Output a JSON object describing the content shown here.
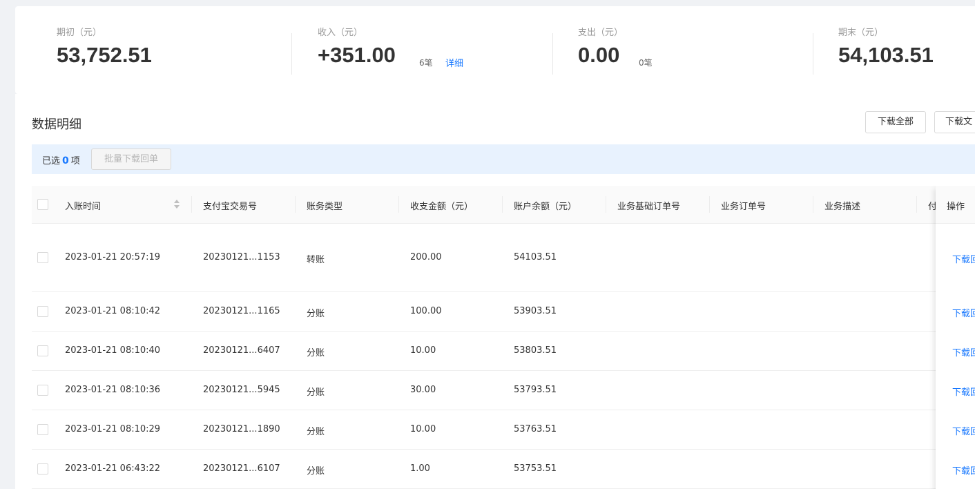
{
  "summary": {
    "opening": {
      "label": "期初（元）",
      "value": "53,752.51"
    },
    "income": {
      "label": "收入（元）",
      "value": "+351.00",
      "count": "6笔",
      "link": "详细"
    },
    "expense": {
      "label": "支出（元）",
      "value": "0.00",
      "count": "0笔"
    },
    "closing": {
      "label": "期末（元）",
      "value": "54,103.51"
    }
  },
  "detail": {
    "title": "数据明细",
    "download_all": "下载全部",
    "download_file": "下载文",
    "selection": {
      "prefix": "已选",
      "count": "0",
      "suffix": "项",
      "batch_button": "批量下载回单"
    }
  },
  "table": {
    "headers": {
      "time": "入账时间",
      "trade_no": "支付宝交易号",
      "type": "账务类型",
      "amount": "收支金额（元）",
      "balance": "账户余额（元）",
      "base_order": "业务基础订单号",
      "order": "业务订单号",
      "desc": "业务描述",
      "extra": "付",
      "op": "操作"
    },
    "rows": [
      {
        "time": "2023-01-21 20:57:19",
        "trade_no": "20230121...1153",
        "type": "转账",
        "amount": "200.00",
        "balance": "54103.51",
        "op": "下载回"
      },
      {
        "time": "2023-01-21 08:10:42",
        "trade_no": "20230121...1165",
        "type": "分账",
        "amount": "100.00",
        "balance": "53903.51",
        "op": "下载回"
      },
      {
        "time": "2023-01-21 08:10:40",
        "trade_no": "20230121...6407",
        "type": "分账",
        "amount": "10.00",
        "balance": "53803.51",
        "op": "下载回"
      },
      {
        "time": "2023-01-21 08:10:36",
        "trade_no": "20230121...5945",
        "type": "分账",
        "amount": "30.00",
        "balance": "53793.51",
        "op": "下载回"
      },
      {
        "time": "2023-01-21 08:10:29",
        "trade_no": "20230121...1890",
        "type": "分账",
        "amount": "10.00",
        "balance": "53763.51",
        "op": "下载回"
      },
      {
        "time": "2023-01-21 06:43:22",
        "trade_no": "20230121...6107",
        "type": "分账",
        "amount": "1.00",
        "balance": "53753.51",
        "op": "下载回"
      }
    ]
  }
}
